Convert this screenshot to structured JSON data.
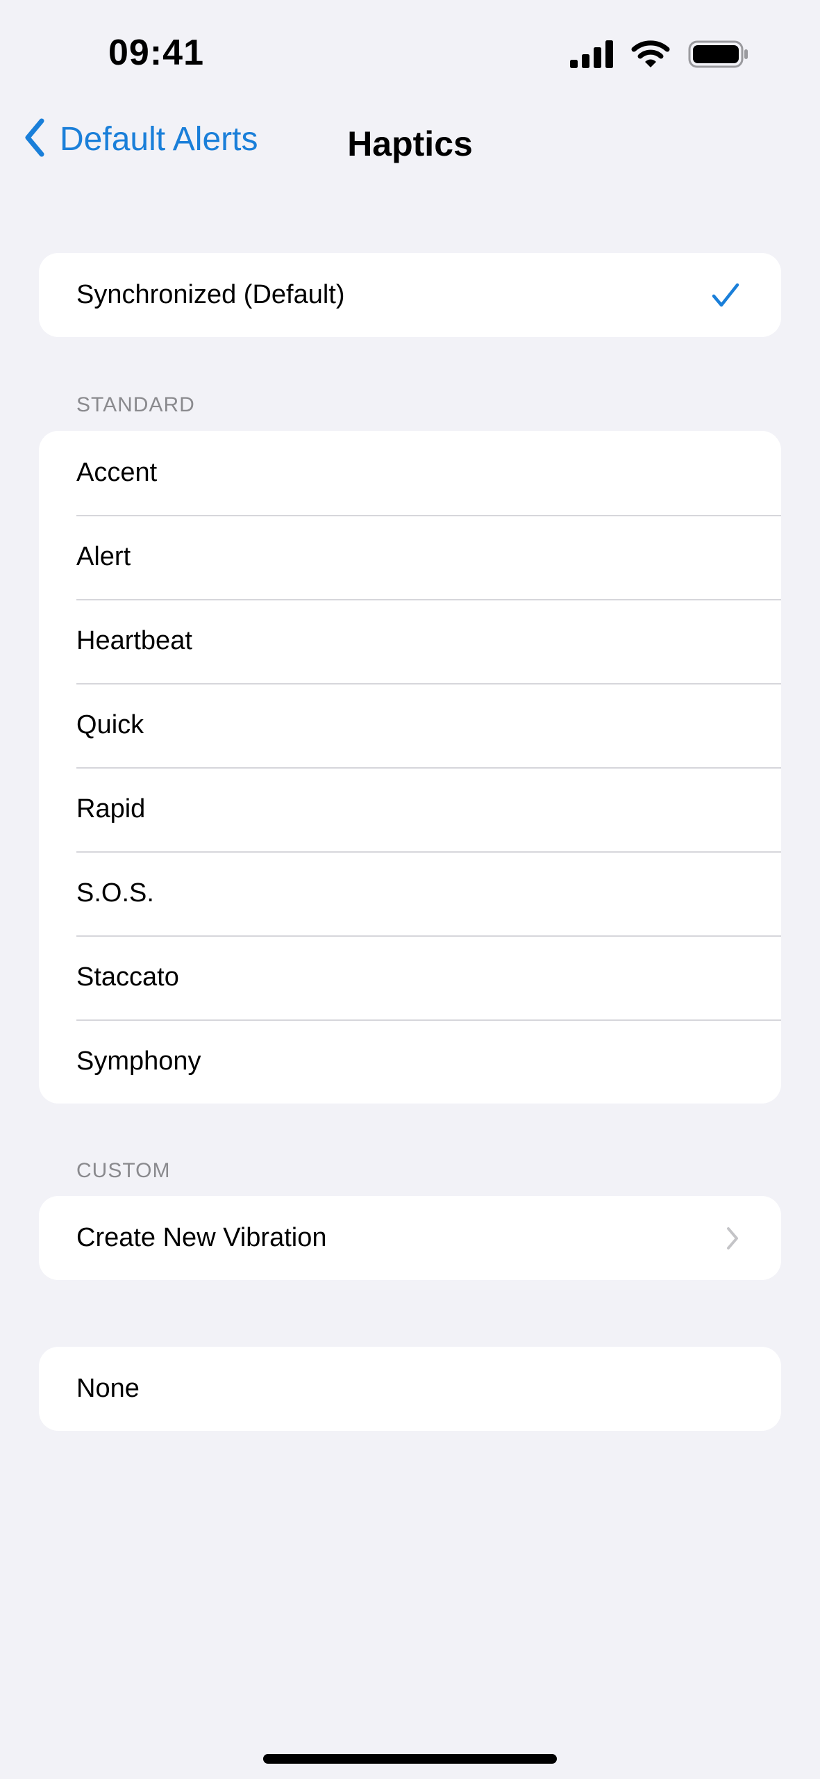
{
  "status_bar": {
    "time": "09:41",
    "icons": [
      "cellular-signal-icon",
      "wifi-icon",
      "battery-icon"
    ]
  },
  "nav": {
    "back_label": "Default Alerts",
    "title": "Haptics"
  },
  "selected": {
    "label": "Synchronized (Default)",
    "checked": true
  },
  "standard": {
    "header": "STANDARD",
    "items": [
      "Accent",
      "Alert",
      "Heartbeat",
      "Quick",
      "Rapid",
      "S.O.S.",
      "Staccato",
      "Symphony"
    ]
  },
  "custom": {
    "header": "CUSTOM",
    "create_label": "Create New Vibration"
  },
  "none_label": "None",
  "colors": {
    "accent": "#1a7fd9",
    "background": "#f2f2f7",
    "separator": "#d6d6db",
    "secondary_text": "#8a8a8e"
  }
}
